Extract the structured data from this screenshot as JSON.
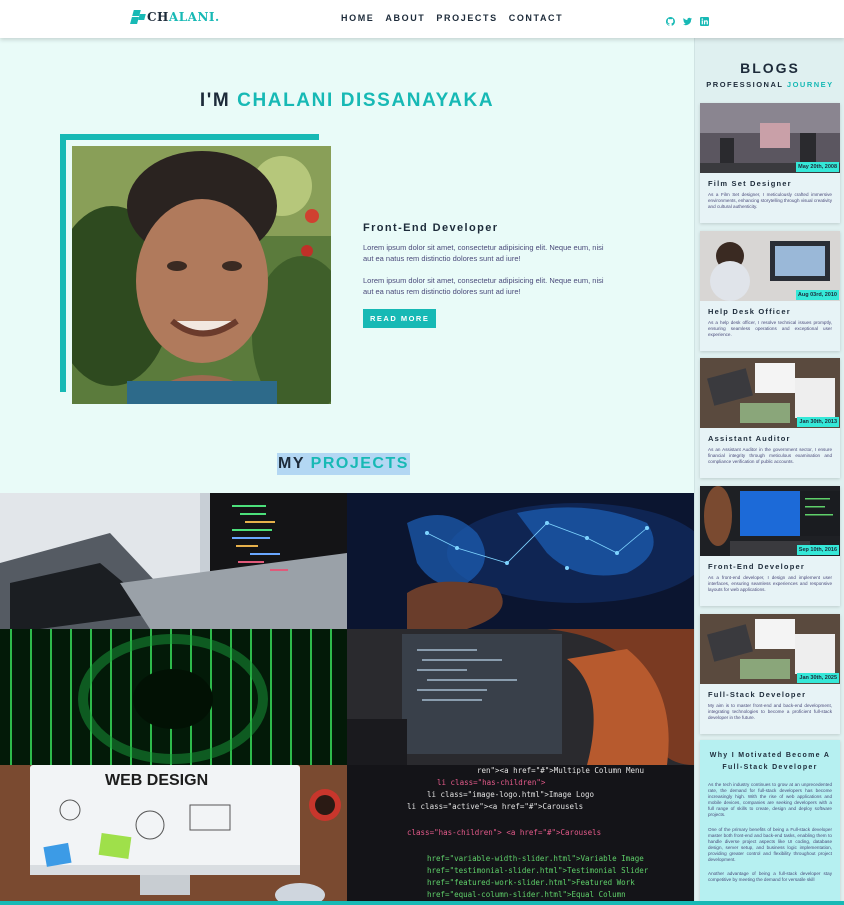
{
  "nav": {
    "logo_part1": "CH",
    "logo_part2": "ALANI",
    "logo_dot": ".",
    "links": [
      "HOME",
      "ABOUT",
      "PROJECTS",
      "CONTACT"
    ],
    "social_icons": [
      "github-icon",
      "twitter-icon",
      "linkedin-icon"
    ]
  },
  "hero": {
    "title_prefix": "I'M ",
    "title_name": "CHALANI DISSANAYAKA",
    "role": "Front-End Developer",
    "paragraphs": [
      "Lorem ipsum dolor sit amet, consectetur adipisicing elit. Neque eum, nisi aut ea natus rem distinctio dolores sunt ad iure!",
      "Lorem ipsum dolor sit amet, consectetur adipisicing elit. Neque eum, nisi aut ea natus rem distinctio dolores sunt ad iure!"
    ],
    "button": "READ MORE"
  },
  "projects": {
    "title_prefix": "MY ",
    "title_accent": "PROJECTS",
    "web_design_text": "WEB DESIGN"
  },
  "blogs": {
    "title": "BLOGS",
    "subtitle_prefix": "PROFESSIONAL ",
    "subtitle_accent": "JOURNEY",
    "cards": [
      {
        "date": "May 20th, 2008",
        "title": "Film Set Designer",
        "text": "As a Film Set designer, I meticulously crafted immersive environments, enhancing storytelling through visual creativity and cultural authenticity."
      },
      {
        "date": "Aug 03rd, 2010",
        "title": "Help Desk Officer",
        "text": "As a help desk officer, I resolve technical issues promptly, ensuring seamless operations and exceptional user experience."
      },
      {
        "date": "Jan 30th, 2013",
        "title": "Assistant Auditor",
        "text": "As an Assistant Auditor in the government sector, I ensure financial integrity through meticulous examination and compliance verification of public accounts."
      },
      {
        "date": "Sep 10th, 2016",
        "title": "Front-End Developer",
        "text": "As a front-end developer, I design and implement user interfaces, ensuring seamless experiences and responsive layouts for web applications."
      },
      {
        "date": "Jan 30th, 2025",
        "title": "Full-Stack Developer",
        "text": "My aim is to master front-end and back-end development, integrating technologies to become a proficient full-stack developer in the future."
      }
    ],
    "motivation": {
      "title": "Why I Motivated Become A Full-Stack Developer",
      "paragraphs": [
        "As the tech industry continues to grow at an unprecedented rate, the demand for full-stack developers has become increasingly high. With the rise of web applications and mobile devices, companies are seeking developers with a full range of skills to create, design and deploy software projects.",
        "One of the primary benefits of being a Full-stack developer master both front-end and back-end tasks, enabling them to handle diverse project aspects like UI coding, database design, server setup, and business logic implementation, providing greater control and flexibility throughout project development.",
        "Another advantage of being a full-stack developer stay competitive by meeting the demand for versatile skill"
      ]
    }
  },
  "colors": {
    "accent": "#17b9b5",
    "background": "#e9fbf8",
    "date_badge": "#35e8d8",
    "dark_text": "#1d2b3a"
  }
}
